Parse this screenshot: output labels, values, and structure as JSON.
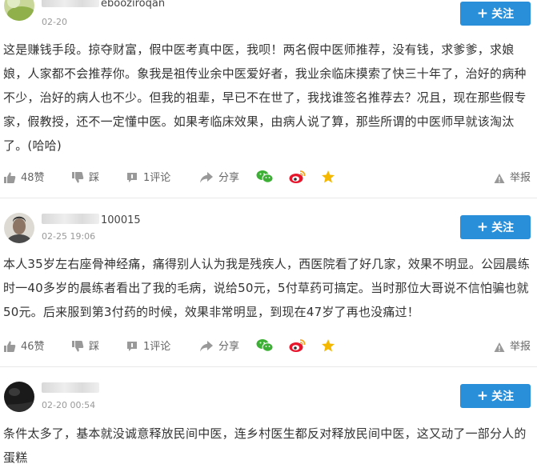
{
  "comments": [
    {
      "username": "ebooziroqan",
      "time": "02-20",
      "follow_label": "关注",
      "text": "这是赚钱手段。掠夺财富，假中医考真中医，我呗！两名假中医师推荐，没有钱，求爹爹，求娘娘，人家都不会推荐你。象我是祖传业余中医爱好者，我业余临床摸索了快三十年了，治好的病种不少，治好的病人也不少。但我的祖辈，早已不在世了，我找谁签名推荐去？况且，现在那些假专家，假教授，还不一定懂中医。如果考临床效果，由病人说了算，那些所谓的中医师早就该淘汰了。(哈哈)",
      "likes": "48赞",
      "dislike": "踩",
      "replies": "1评论",
      "share": "分享",
      "report": "举报"
    },
    {
      "username": "100015",
      "time": "02-25 19:06",
      "follow_label": "关注",
      "text": "本人35岁左右座骨神经痛，痛得别人认为我是残疾人，西医院看了好几家，效果不明显。公园晨练时一40多岁的晨练者看出了我的毛病，说给50元，5付草药可搞定。当时那位大哥说不信怕骗也就50元。后来服到第3付药的时候，效果非常明显，到现在47岁了再也没痛过！",
      "likes": "46赞",
      "dislike": "踩",
      "replies": "1评论",
      "share": "分享",
      "report": "举报"
    },
    {
      "username": "",
      "time": "02-20 00:54",
      "follow_label": "关注",
      "text": "条件太多了，基本就没诚意释放民间中医，连乡村医生都反对释放民间中医，这又动了一部分人的蛋糕"
    }
  ],
  "colors": {
    "follow_button": "#2a8fd9",
    "wechat": "#3cb034",
    "weibo": "#e6162d",
    "star": "#f5b800",
    "icon_gray": "#999999"
  },
  "icons": [
    "thumbs-up-icon",
    "thumbs-down-icon",
    "comment-icon",
    "share-icon",
    "wechat-icon",
    "weibo-icon",
    "star-icon",
    "report-icon",
    "plus-icon"
  ]
}
